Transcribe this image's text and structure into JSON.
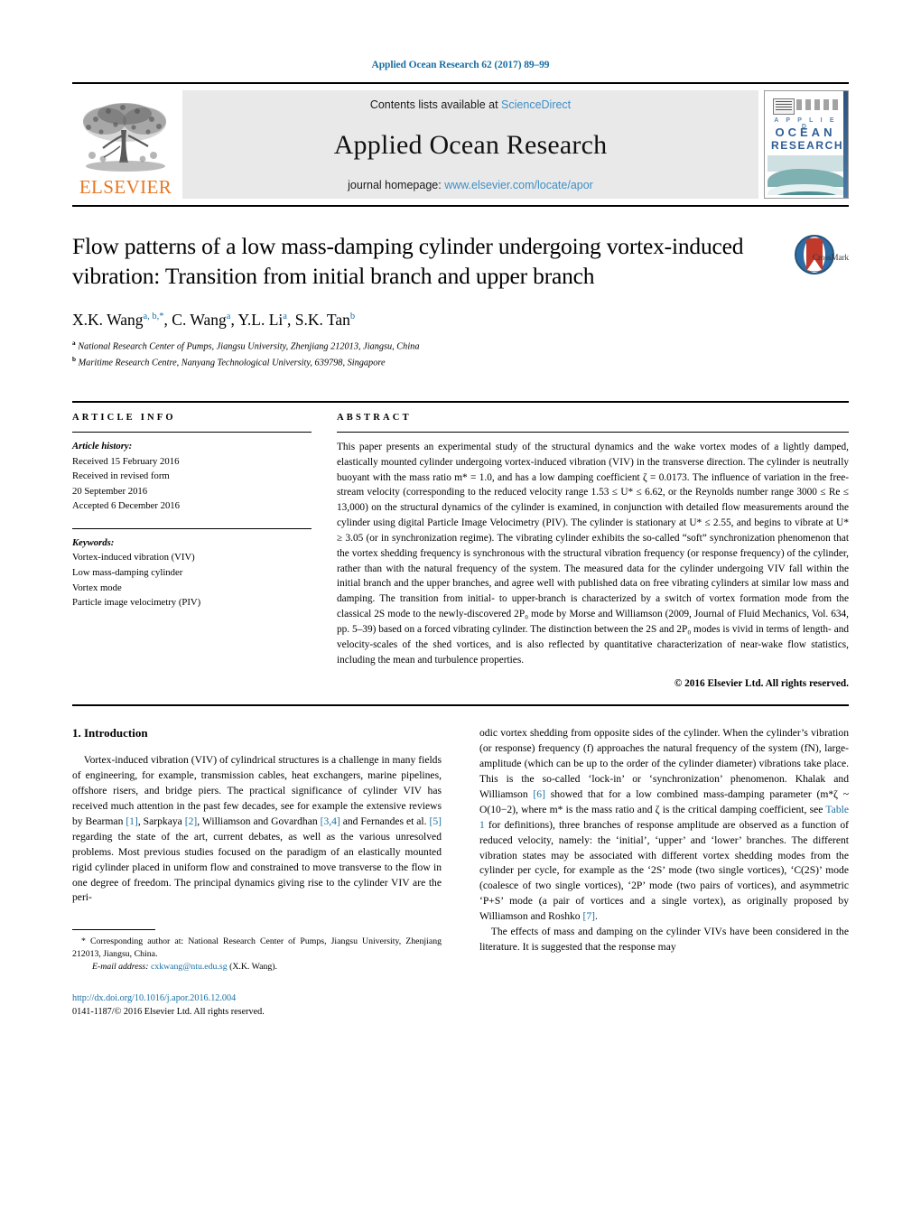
{
  "running_head": "Applied Ocean Research 62 (2017) 89–99",
  "masthead": {
    "publisher_name": "ELSEVIER",
    "contents_prefix": "Contents lists available at ",
    "contents_link": "ScienceDirect",
    "journal_title": "Applied Ocean Research",
    "homepage_prefix": "journal homepage: ",
    "homepage_link": "www.elsevier.com/locate/apor",
    "cover": {
      "line1": "A P P L I E D",
      "line2": "OCEAN",
      "line3": "RESEARCH"
    }
  },
  "article": {
    "title": "Flow patterns of a low mass-damping cylinder undergoing vortex-induced vibration: Transition from initial branch and upper branch",
    "crossmark_label": "CrossMark",
    "authors_html": "X.K. Wang<sup>a, b,</sup><sup>*</sup>, C. Wang<sup>a</sup>, Y.L. Li<sup>a</sup>, S.K. Tan<sup>b</sup>",
    "affiliation_a": "National Research Center of Pumps, Jiangsu University, Zhenjiang 212013, Jiangsu, China",
    "affiliation_b": "Maritime Research Centre, Nanyang Technological University, 639798, Singapore"
  },
  "info": {
    "heading": "ARTICLE INFO",
    "history_title": "Article history:",
    "history_lines": [
      "Received 15 February 2016",
      "Received in revised form",
      "20 September 2016",
      "Accepted 6 December 2016"
    ],
    "keywords_title": "Keywords:",
    "keywords": [
      "Vortex-induced vibration (VIV)",
      "Low mass-damping cylinder",
      "Vortex mode",
      "Particle image velocimetry (PIV)"
    ]
  },
  "abstract": {
    "heading": "ABSTRACT",
    "text": "This paper presents an experimental study of the structural dynamics and the wake vortex modes of a lightly damped, elastically mounted cylinder undergoing vortex-induced vibration (VIV) in the transverse direction. The cylinder is neutrally buoyant with the mass ratio m* = 1.0, and has a low damping coefficient ζ = 0.0173. The influence of variation in the free-stream velocity (corresponding to the reduced velocity range 1.53 ≤ U* ≤ 6.62, or the Reynolds number range 3000 ≤ Re ≤ 13,000) on the structural dynamics of the cylinder is examined, in conjunction with detailed flow measurements around the cylinder using digital Particle Image Velocimetry (PIV). The cylinder is stationary at U* ≤ 2.55, and begins to vibrate at U* ≥ 3.05 (or in synchronization regime). The vibrating cylinder exhibits the so-called “soft” synchronization phenomenon that the vortex shedding frequency is synchronous with the structural vibration frequency (or response frequency) of the cylinder, rather than with the natural frequency of the system. The measured data for the cylinder undergoing VIV fall within the initial branch and the upper branches, and agree well with published data on free vibrating cylinders at similar low mass and damping. The transition from initial- to upper-branch is characterized by a switch of vortex formation mode from the classical 2S mode to the newly-discovered 2P₀ mode by Morse and Williamson (2009, Journal of Fluid Mechanics, Vol. 634, pp. 5–39) based on a forced vibrating cylinder. The distinction between the 2S and 2P₀ modes is vivid in terms of length- and velocity-scales of the shed vortices, and is also reflected by quantitative characterization of near-wake flow statistics, including the mean and turbulence properties.",
    "copyright": "© 2016 Elsevier Ltd. All rights reserved."
  },
  "body": {
    "section_number_title": "1.  Introduction",
    "left_paragraph": "Vortex-induced vibration (VIV) of cylindrical structures is a challenge in many fields of engineering, for example, transmission cables, heat exchangers, marine pipelines, offshore risers, and bridge piers. The practical significance of cylinder VIV has received much attention in the past few decades, see for example the extensive reviews by Bearman [1], Sarpkaya [2], Williamson and Govardhan [3,4] and Fernandes et al. [5] regarding the state of the art, current debates, as well as the various unresolved problems. Most previous studies focused on the paradigm of an elastically mounted rigid cylinder placed in uniform flow and constrained to move transverse to the flow in one degree of freedom. The principal dynamics giving rise to the cylinder VIV are the peri-",
    "right_paragraph_1": "odic vortex shedding from opposite sides of the cylinder. When the cylinder’s vibration (or response) frequency (f) approaches the natural frequency of the system (fN), large-amplitude (which can be up to the order of the cylinder diameter) vibrations take place. This is the so-called ‘lock-in’ or ‘synchronization’ phenomenon. Khalak and Williamson [6] showed that for a low combined mass-damping parameter (m*ζ ~ O(10−2), where m* is the mass ratio and ζ is the critical damping coefficient, see Table 1 for definitions), three branches of response amplitude are observed as a function of reduced velocity, namely: the ‘initial’, ‘upper’ and ‘lower’ branches. The different vibration states may be associated with different vortex shedding modes from the cylinder per cycle, for example as the ‘2S’ mode (two single vortices), ‘C(2S)’ mode (coalesce of two single vortices), ‘2P’ mode (two pairs of vortices), and asymmetric ‘P+S’ mode (a pair of vortices and a single vortex), as originally proposed by Williamson and Roshko [7].",
    "right_paragraph_2": "The effects of mass and damping on the cylinder VIVs have been considered in the literature. It is suggested that the response may",
    "citations": [
      "1",
      "2",
      "3,4",
      "5",
      "6",
      "7"
    ],
    "table_link": "Table 1"
  },
  "footnote": {
    "corresponding": "* Corresponding author at: National Research Center of Pumps, Jiangsu University, Zhenjiang 212013, Jiangsu, China.",
    "email_label": "E-mail address:",
    "email": "cxkwang@ntu.edu.sg",
    "email_suffix": " (X.K. Wang)."
  },
  "doi": {
    "url": "http://dx.doi.org/10.1016/j.apor.2016.12.004",
    "issn_line": "0141-1187/© 2016 Elsevier Ltd. All rights reserved."
  },
  "colors": {
    "link_blue": "#1a6fa3",
    "sd_blue": "#3f8fc5",
    "elsevier_orange": "#E87722",
    "cover_blue": "#2f5f96",
    "cover_teal": "#4e8f93"
  }
}
